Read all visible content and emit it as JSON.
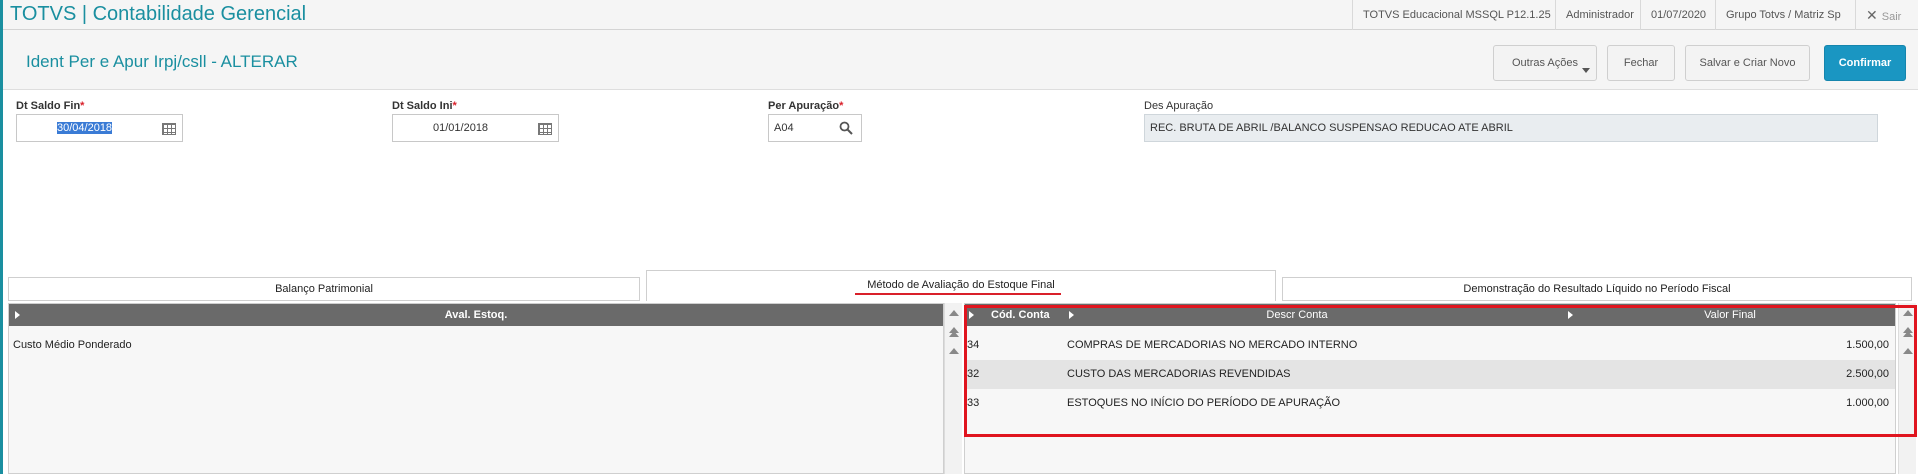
{
  "app": {
    "title": "TOTVS | Contabilidade Gerencial",
    "environment": "TOTVS Educacional MSSQL P12.1.25",
    "user": "Administrador",
    "date": "01/07/2020",
    "company": "Grupo Totvs / Matriz Sp",
    "exit_label": "Sair"
  },
  "header": {
    "title": "Ident Per e Apur Irpj/csll - ALTERAR",
    "buttons": {
      "other_actions": "Outras Ações",
      "close": "Fechar",
      "save_new": "Salvar e Criar Novo",
      "confirm": "Confirmar"
    }
  },
  "form": {
    "dt_saldo_fin": {
      "label": "Dt Saldo Fin",
      "value": "30/04/2018"
    },
    "dt_saldo_ini": {
      "label": "Dt Saldo Ini",
      "value": "01/01/2018"
    },
    "per_apuracao": {
      "label": "Per Apuração",
      "value": "A04"
    },
    "des_apuracao": {
      "label": "Des Apuração",
      "value": "REC. BRUTA DE ABRIL /BALANCO SUSPENSAO REDUCAO ATE ABRIL"
    },
    "required_mark": "*"
  },
  "tabs": [
    {
      "label": "Balanço Patrimonial",
      "active": false
    },
    {
      "label": "Método de Avaliação do Estoque Final",
      "active": true
    },
    {
      "label": "Demonstração do Resultado Líquido no Período Fiscal",
      "active": false
    }
  ],
  "left_grid": {
    "header": "Aval. Estoq.",
    "rows": [
      "Custo Médio Ponderado"
    ]
  },
  "right_grid": {
    "headers": {
      "code": "Cód. Conta",
      "desc": "Descr Conta",
      "value": "Valor Final"
    },
    "rows": [
      {
        "code": "34",
        "desc": "COMPRAS DE MERCADORIAS NO MERCADO INTERNO",
        "value": "1.500,00"
      },
      {
        "code": "32",
        "desc": "CUSTO DAS MERCADORIAS REVENDIDAS",
        "value": "2.500,00"
      },
      {
        "code": "33",
        "desc": "ESTOQUES NO INÍCIO DO PERÍODO DE APURAÇÃO",
        "value": "1.000,00"
      }
    ]
  },
  "colors": {
    "accent": "#1a8fa0",
    "primary_button": "#1a96c2",
    "required": "#d9202a",
    "highlight": "#e0151f"
  }
}
